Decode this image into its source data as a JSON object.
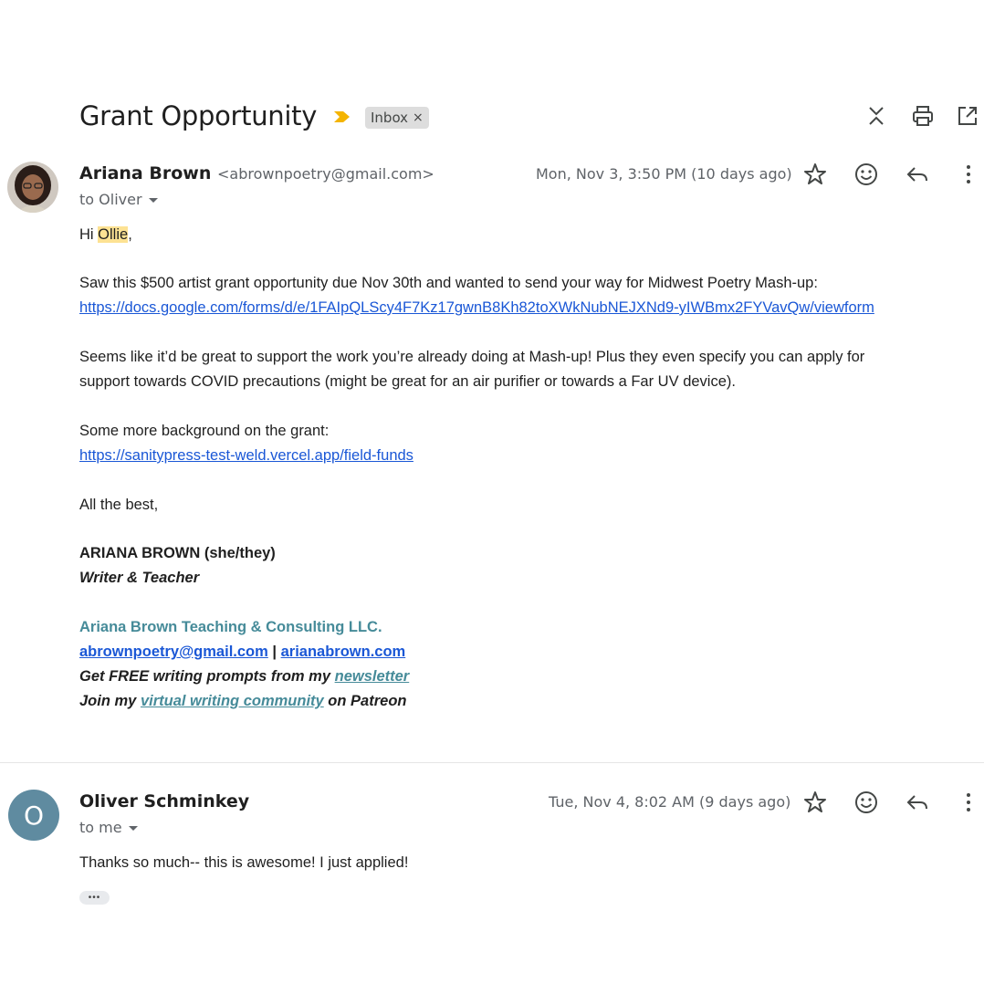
{
  "thread": {
    "subject": "Grant Opportunity",
    "label": "Inbox",
    "label_remove_glyph": "×",
    "importance_color": "#f4b400",
    "icons": [
      "expand-collapse-icon",
      "print-icon",
      "open-new-window-icon"
    ]
  },
  "message1": {
    "sender_name": "Ariana Brown",
    "sender_email": "<abrownpoetry@gmail.com>",
    "recipient": "to Oliver",
    "date": "Mon, Nov 3, 3:50 PM (10 days ago)",
    "body": {
      "greeting_prefix": "Hi ",
      "greeting_name": "Ollie",
      "greeting_suffix": ",",
      "para1": "Saw this $500 artist grant opportunity due Nov 30th and wanted to send your way for Midwest Poetry Mash-up:",
      "link1": "https://docs.google.com/forms/d/e/1FAIpQLScy4F7Kz17gwnB8Kh82toXWkNubNEJXNd9-yIWBmx2FYVavQw/viewform",
      "para2_line1": "Seems like it’d be great to support the work you’re already doing at Mash-up! Plus they even specify you can apply for",
      "para2_line2": "support towards COVID precautions (might be great for an air purifier or towards a Far UV device).",
      "para3": "Some more background on the grant:",
      "link2": "https://sanitypress-test-weld.vercel.app/field-funds",
      "closing": "All the best,",
      "sig_name": "ARIANA BROWN (she/they)",
      "sig_title": "Writer & Teacher",
      "sig_company": "Ariana Brown Teaching & Consulting LLC.",
      "sig_email": "abrownpoetry@gmail.com",
      "sig_sep": " | ",
      "sig_site": "arianabrown.com",
      "sig_prompts_prefix": "Get FREE writing prompts from my ",
      "sig_prompts_link": "newsletter",
      "sig_patreon_prefix": "Join my ",
      "sig_patreon_link": "virtual writing community",
      "sig_patreon_suffix": " on Patreon"
    }
  },
  "message2": {
    "sender_name": "Oliver Schminkey",
    "avatar_initial": "O",
    "recipient": "to me",
    "date": "Tue, Nov 4, 8:02 AM (9 days ago)",
    "body": "Thanks so much-- this is awesome! I just applied!",
    "show_trimmed": "•••"
  },
  "colors": {
    "link_blue": "#1a57d6",
    "signature_teal": "#468b99",
    "highlight": "#fde293"
  }
}
